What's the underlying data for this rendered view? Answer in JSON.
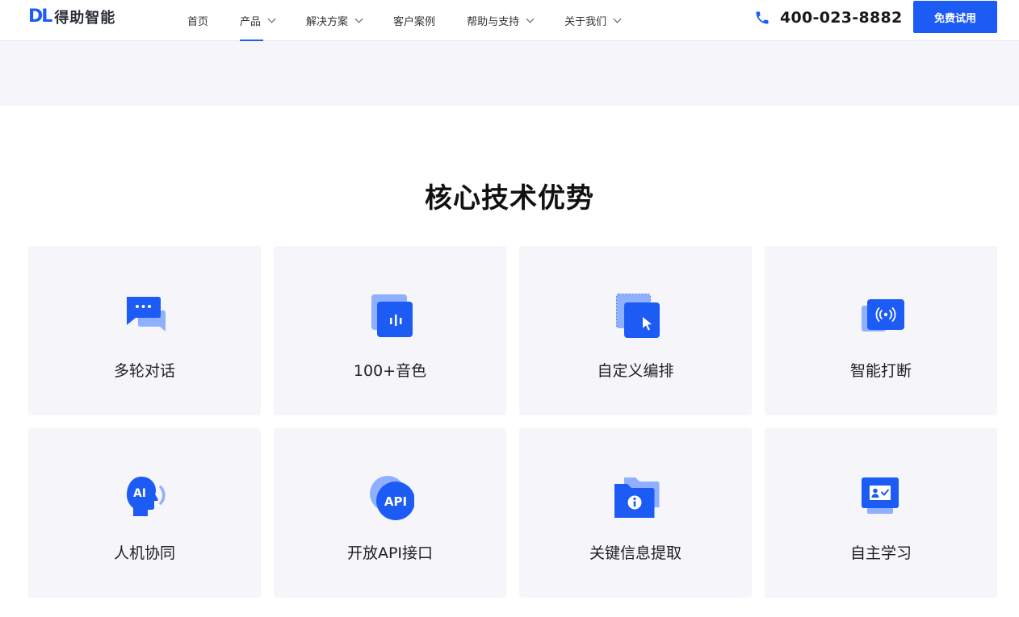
{
  "header": {
    "logo_mark": "DL",
    "logo_brand": "得助智能",
    "nav": [
      {
        "label": "首页",
        "has_dropdown": false
      },
      {
        "label": "产品",
        "has_dropdown": true,
        "active": true
      },
      {
        "label": "解决方案",
        "has_dropdown": true
      },
      {
        "label": "客户案例",
        "has_dropdown": false
      },
      {
        "label": "帮助与支持",
        "has_dropdown": true
      },
      {
        "label": "关于我们",
        "has_dropdown": true
      }
    ],
    "phone": "400-023-8882",
    "trial_button": "免费试用"
  },
  "section": {
    "title": "核心技术优势",
    "cards": [
      {
        "label": "多轮对话",
        "icon": "chat-bubbles-icon"
      },
      {
        "label": "100+音色",
        "icon": "voice-tone-icon"
      },
      {
        "label": "自定义编排",
        "icon": "cursor-select-icon"
      },
      {
        "label": "智能打断",
        "icon": "signal-interrupt-icon"
      },
      {
        "label": "人机协同",
        "icon": "ai-head-icon"
      },
      {
        "label": "开放API接口",
        "icon": "api-icon"
      },
      {
        "label": "关键信息提取",
        "icon": "info-folder-icon"
      },
      {
        "label": "自主学习",
        "icon": "id-card-check-icon"
      }
    ]
  },
  "colors": {
    "accent": "#1d5bf5",
    "accent_light": "#8fb0ff",
    "card_bg": "#f5f5fa"
  }
}
